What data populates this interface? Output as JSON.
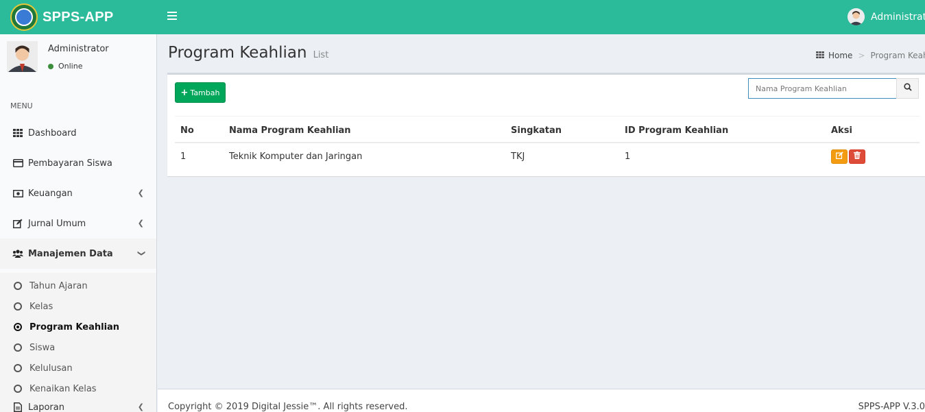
{
  "app": {
    "name": "SPPS-APP"
  },
  "header": {
    "user_name": "Administrator"
  },
  "sidebar": {
    "user": {
      "name": "Administrator",
      "status": "Online"
    },
    "menu_header": "MENU",
    "items": [
      {
        "label": "Dashboard",
        "icon": "grid-icon"
      },
      {
        "label": "Pembayaran Siswa",
        "icon": "credit-card-icon"
      },
      {
        "label": "Keuangan",
        "icon": "money-icon"
      },
      {
        "label": "Jurnal Umum",
        "icon": "edit-icon"
      },
      {
        "label": "Manajemen Data",
        "icon": "users-icon"
      },
      {
        "label": "Laporan",
        "icon": "file-icon"
      }
    ],
    "submenu": [
      {
        "label": "Tahun Ajaran"
      },
      {
        "label": "Kelas"
      },
      {
        "label": "Program Keahlian"
      },
      {
        "label": "Siswa"
      },
      {
        "label": "Kelulusan"
      },
      {
        "label": "Kenaikan Kelas"
      }
    ]
  },
  "page": {
    "title": "Program Keahlian",
    "subtitle": "List",
    "breadcrumb": {
      "home": "Home",
      "current": "Program Keahlian"
    }
  },
  "toolbar": {
    "add_label": "Tambah",
    "search_placeholder": "Nama Program Keahlian"
  },
  "table": {
    "headers": [
      "No",
      "Nama Program Keahlian",
      "Singkatan",
      "ID Program Keahlian",
      "Aksi"
    ],
    "rows": [
      {
        "no": "1",
        "nama": "Teknik Komputer dan Jaringan",
        "singkatan": "TKJ",
        "id": "1"
      }
    ]
  },
  "footer": {
    "copyright": "Copyright © 2019 Digital Jessie™. All rights reserved.",
    "version": "SPPS-APP V.3.0"
  },
  "colors": {
    "topbar": "#2bbb9a",
    "add_button": "#00a65a",
    "edit_button": "#f39c12",
    "delete_button": "#dd4b39"
  }
}
